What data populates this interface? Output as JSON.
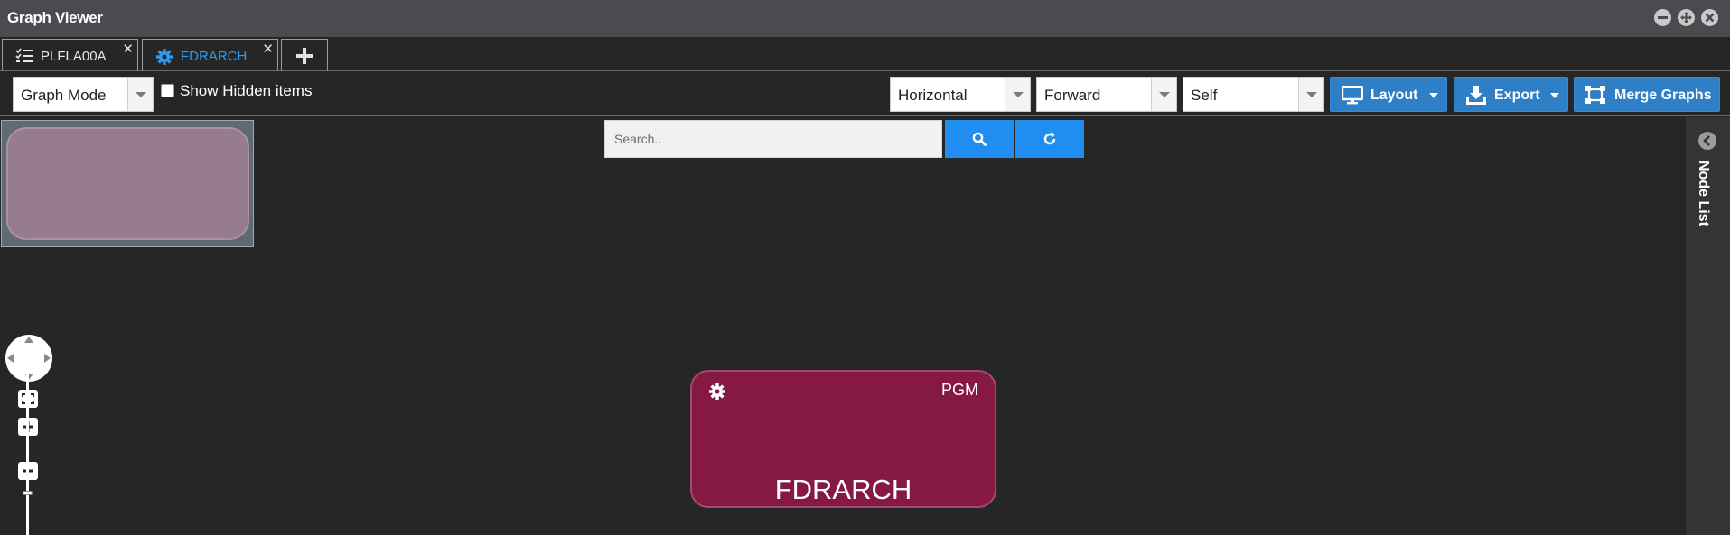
{
  "window": {
    "title": "Graph Viewer"
  },
  "tabs": [
    {
      "label": "PLFLA00A",
      "icon": "checklist-icon",
      "active": false
    },
    {
      "label": "FDRARCH",
      "icon": "gear-icon",
      "active": true
    }
  ],
  "toolbar": {
    "mode_select": "Graph Mode",
    "show_hidden_label": "Show Hidden items",
    "show_hidden_checked": false,
    "orientation_select": "Horizontal",
    "direction_select": "Forward",
    "scope_select": "Self",
    "layout_label": "Layout",
    "export_label": "Export",
    "merge_label": "Merge Graphs"
  },
  "search": {
    "placeholder": "Search.."
  },
  "node": {
    "type": "PGM",
    "name": "FDRARCH",
    "color": "#861943"
  },
  "sidebar": {
    "label": "Node List"
  },
  "colors": {
    "accent": "#2f7fc7",
    "search_button": "#1f8ef0",
    "active_tab": "#2d9af0"
  }
}
